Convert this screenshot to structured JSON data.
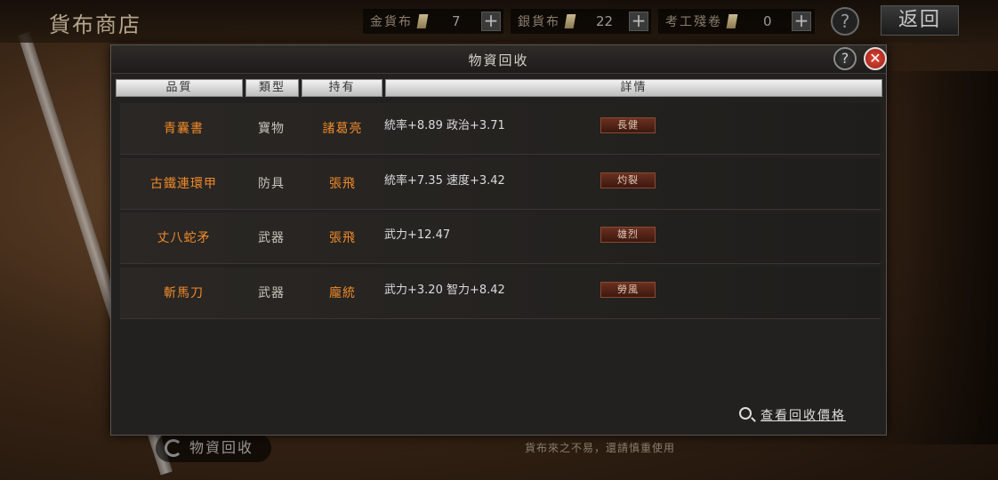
{
  "topbar": {
    "shop_title": "貨布商店",
    "currencies": [
      {
        "label": "金貨布",
        "value": "7"
      },
      {
        "label": "銀貨布",
        "value": "22"
      },
      {
        "label": "考工殘卷",
        "value": "0"
      }
    ],
    "help_symbol": "?",
    "back_label": "返回"
  },
  "modal": {
    "title": "物資回收",
    "help_symbol": "?",
    "close_symbol": "✕",
    "columns": [
      "品質",
      "類型",
      "持有",
      "詳情"
    ],
    "rows": [
      {
        "name": "青囊書",
        "type": "寶物",
        "owner": "諸葛亮",
        "stats": "統率+8.89  政治+3.71",
        "badge": "長健"
      },
      {
        "name": "古鐵連環甲",
        "type": "防具",
        "owner": "張飛",
        "stats": "統率+7.35  速度+3.42",
        "badge": "灼裂"
      },
      {
        "name": "丈八蛇矛",
        "type": "武器",
        "owner": "張飛",
        "stats": "武力+12.47",
        "badge": "雄烈"
      },
      {
        "name": "斬馬刀",
        "type": "武器",
        "owner": "龐統",
        "stats": "武力+3.20  智力+8.42",
        "badge": "勞風"
      }
    ],
    "view_price_label": "查看回收價格"
  },
  "bottom": {
    "recycle_tab_label": "物資回收",
    "note": "貨布來之不易，還請慎重使用"
  },
  "colors": {
    "orange_text": "#f08a2a",
    "close_red": "#d03a2a"
  }
}
